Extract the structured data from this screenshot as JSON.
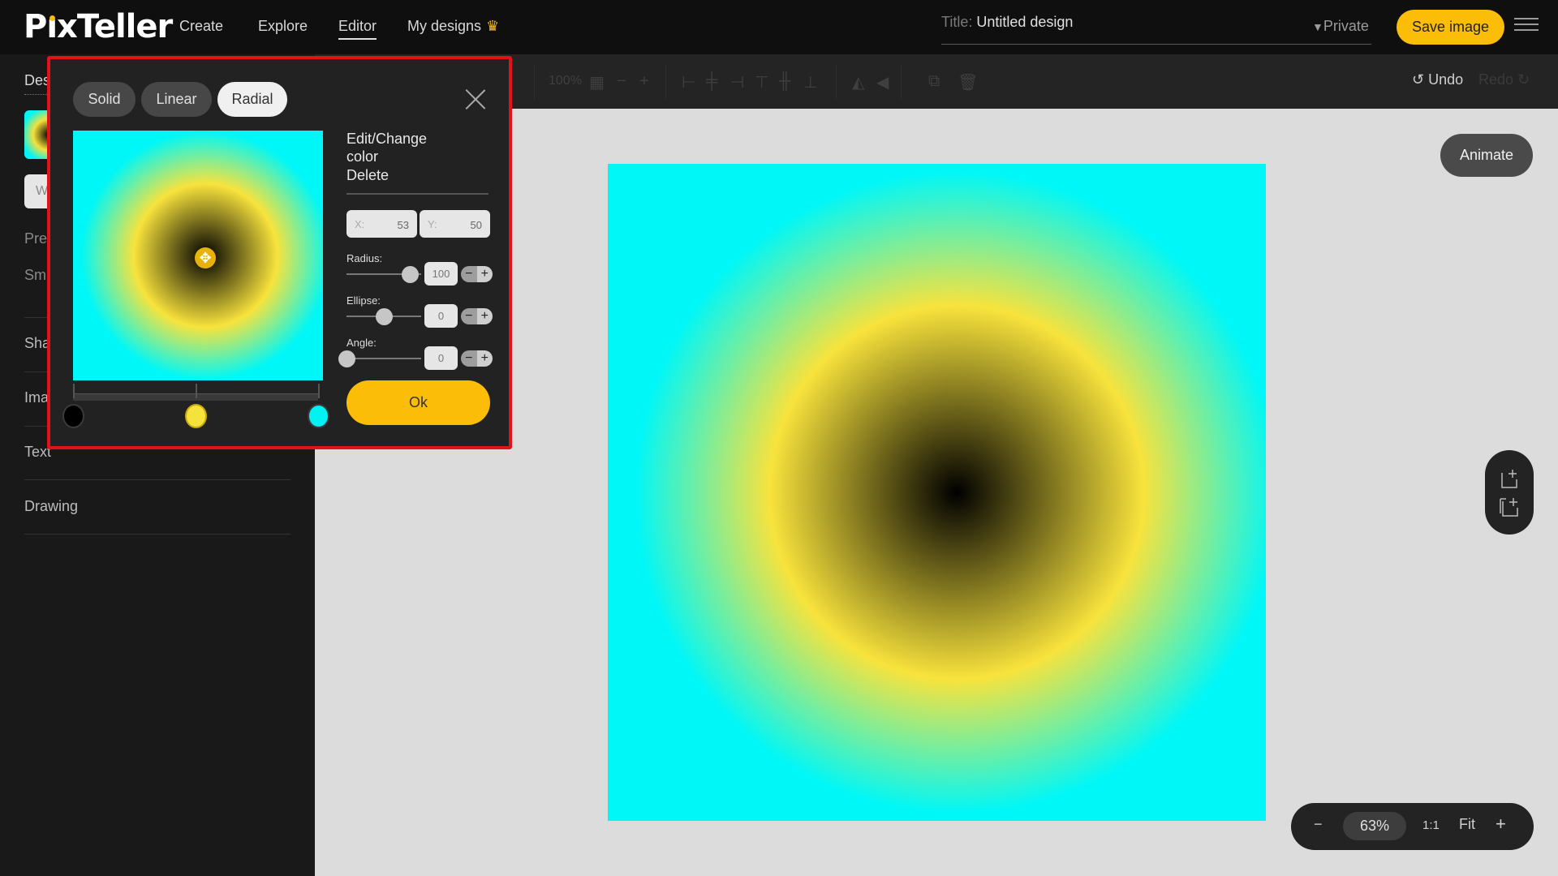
{
  "header": {
    "logo": "PixTeller",
    "nav": [
      {
        "label": "Create"
      },
      {
        "label": "Explore"
      },
      {
        "label": "Editor",
        "active": true
      },
      {
        "label": "My designs",
        "badge_icon": "crown-icon"
      }
    ],
    "title_label": "Title:",
    "title_value": "Untitled design",
    "privacy": "Private",
    "save_label": "Save image"
  },
  "sidebar": {
    "tab_label": "Des",
    "button_label": "W",
    "small_labels": [
      "Pre",
      "Sm"
    ],
    "items": [
      {
        "label": "Sha"
      },
      {
        "label": "Ima"
      },
      {
        "label": "Text"
      },
      {
        "label": "Drawing"
      }
    ]
  },
  "toolbar": {
    "zoom_text": "100%",
    "undo_label": "Undo",
    "redo_label": "Redo"
  },
  "canvas": {
    "animate_label": "Animate",
    "gradient": {
      "type": "radial",
      "stops": [
        {
          "color": "#000000",
          "position": 0
        },
        {
          "color": "#f8e33c",
          "position": 0.5
        },
        {
          "color": "#00f7f7",
          "position": 1
        }
      ]
    }
  },
  "zoom_controls": {
    "minus": "−",
    "percent": "63%",
    "one_to_one": "1:1",
    "fit": "Fit",
    "plus": "+"
  },
  "gradient_popup": {
    "tabs": [
      {
        "label": "Solid"
      },
      {
        "label": "Linear"
      },
      {
        "label": "Radial",
        "active": true
      }
    ],
    "edit_change_label": "Edit/Change color",
    "delete_label": "Delete",
    "x_label": "X:",
    "x_value": "53",
    "y_label": "Y:",
    "y_value": "50",
    "radius_label": "Radius:",
    "radius_value": "100",
    "radius_fraction": 0.85,
    "ellipse_label": "Ellipse:",
    "ellipse_value": "0",
    "ellipse_fraction": 0.5,
    "angle_label": "Angle:",
    "angle_value": "0",
    "angle_fraction": 0.0,
    "ok_label": "Ok",
    "color_stops": [
      {
        "color": "#000000",
        "position": 0
      },
      {
        "color": "#f5e23a",
        "position": 0.5
      },
      {
        "color": "#00f2f2",
        "position": 1
      }
    ]
  },
  "colors": {
    "accent": "#fbbd08",
    "popup_border": "#e0131a"
  }
}
